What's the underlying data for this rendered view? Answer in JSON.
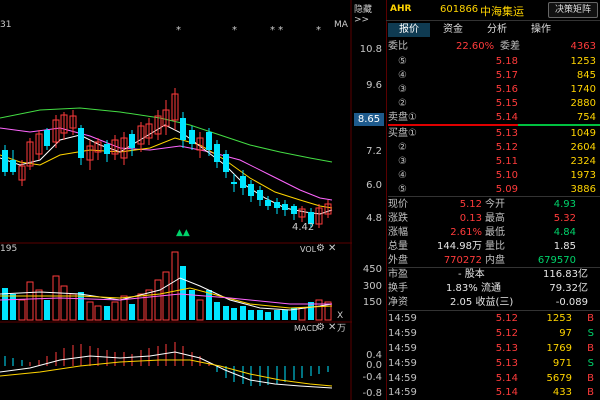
{
  "header": {
    "hide_label": "隐藏>>",
    "back_icon": "back-arrow-icon",
    "code_badge": "AHR",
    "stock_code": "601866",
    "stock_name": "中海集运",
    "decision_button": "决策矩阵"
  },
  "chart": {
    "top_left_label": "31",
    "ma_label": "MA",
    "price_axis": [
      "10.8",
      "9.6",
      "8.65",
      "7.2",
      "6.0",
      "4.8"
    ],
    "low_label": "4.42",
    "star_marks": [
      "*",
      "*",
      "* *",
      "*"
    ],
    "arrow_marks": "▲▲",
    "volume_label": "VOL",
    "volume_left_label": "195",
    "volume_axis": [
      "450",
      "300",
      "150"
    ],
    "volume_unit": "X万",
    "macd_label": "MACD",
    "macd_axis": [
      "0.4",
      "0.0",
      "-0.4",
      "-0.8"
    ],
    "gear_icon": "gear-icon",
    "close_icon": "close-icon"
  },
  "tabs": [
    {
      "label": "报价",
      "active": true
    },
    {
      "label": "资金",
      "active": false
    },
    {
      "label": "分析",
      "active": false
    },
    {
      "label": "操作",
      "active": false
    }
  ],
  "orderbook": {
    "webi_label": "委比",
    "webi_value": "22.60%",
    "weicha_label": "委差",
    "weicha_value": "4363",
    "sell_label": "卖盘①",
    "buy_label": "买盘①",
    "sells": [
      {
        "level": "⑤",
        "price": "5.18",
        "vol": "1253"
      },
      {
        "level": "④",
        "price": "5.17",
        "vol": "845"
      },
      {
        "level": "③",
        "price": "5.16",
        "vol": "1740"
      },
      {
        "level": "②",
        "price": "5.15",
        "vol": "2880"
      },
      {
        "level": "",
        "price": "5.14",
        "vol": "754"
      }
    ],
    "buys": [
      {
        "level": "",
        "price": "5.13",
        "vol": "1049"
      },
      {
        "level": "②",
        "price": "5.12",
        "vol": "2604"
      },
      {
        "level": "③",
        "price": "5.11",
        "vol": "2324"
      },
      {
        "level": "④",
        "price": "5.10",
        "vol": "1973"
      },
      {
        "level": "⑤",
        "price": "5.09",
        "vol": "3886"
      }
    ]
  },
  "quote": [
    {
      "l1": "现价",
      "v1": "5.12",
      "l2": "今开",
      "v2": "4.93",
      "c1": "red",
      "c2": "green"
    },
    {
      "l1": "涨跌",
      "v1": "0.13",
      "l2": "最高",
      "v2": "5.32",
      "c1": "red",
      "c2": "red"
    },
    {
      "l1": "涨幅",
      "v1": "2.61%",
      "l2": "最低",
      "v2": "4.84",
      "c1": "red",
      "c2": "green"
    },
    {
      "l1": "总量",
      "v1": "144.98万",
      "l2": "量比",
      "v2": "1.85",
      "c1": "white",
      "c2": "white"
    },
    {
      "l1": "外盘",
      "v1": "770272",
      "l2": "内盘",
      "v2": "679570",
      "c1": "red",
      "c2": "green"
    }
  ],
  "finance": [
    {
      "l1": "市盈",
      "v1": "- 股本",
      "v2": "116.83亿"
    },
    {
      "l1": "换手",
      "v1": "1.83% 流通",
      "v2": "79.32亿"
    },
    {
      "l1": "净资",
      "v1": "2.05 收益(三)",
      "v2": "-0.089"
    }
  ],
  "ticks": [
    {
      "time": "14:59",
      "price": "5.12",
      "vol": "1253",
      "flag": "B"
    },
    {
      "time": "14:59",
      "price": "5.12",
      "vol": "97",
      "flag": "S"
    },
    {
      "time": "14:59",
      "price": "5.13",
      "vol": "1769",
      "flag": "B"
    },
    {
      "time": "14:59",
      "price": "5.13",
      "vol": "971",
      "flag": "S"
    },
    {
      "time": "14:59",
      "price": "5.14",
      "vol": "5679",
      "flag": "B"
    },
    {
      "time": "14:59",
      "price": "5.14",
      "vol": "433",
      "flag": "B"
    }
  ],
  "colors": {
    "up": "#ff3b3b",
    "down": "#00e5ff",
    "ma5": "#ffffff",
    "ma10": "#ffd400",
    "ma20": "#ff66ff",
    "ma60": "#44dd44"
  }
}
